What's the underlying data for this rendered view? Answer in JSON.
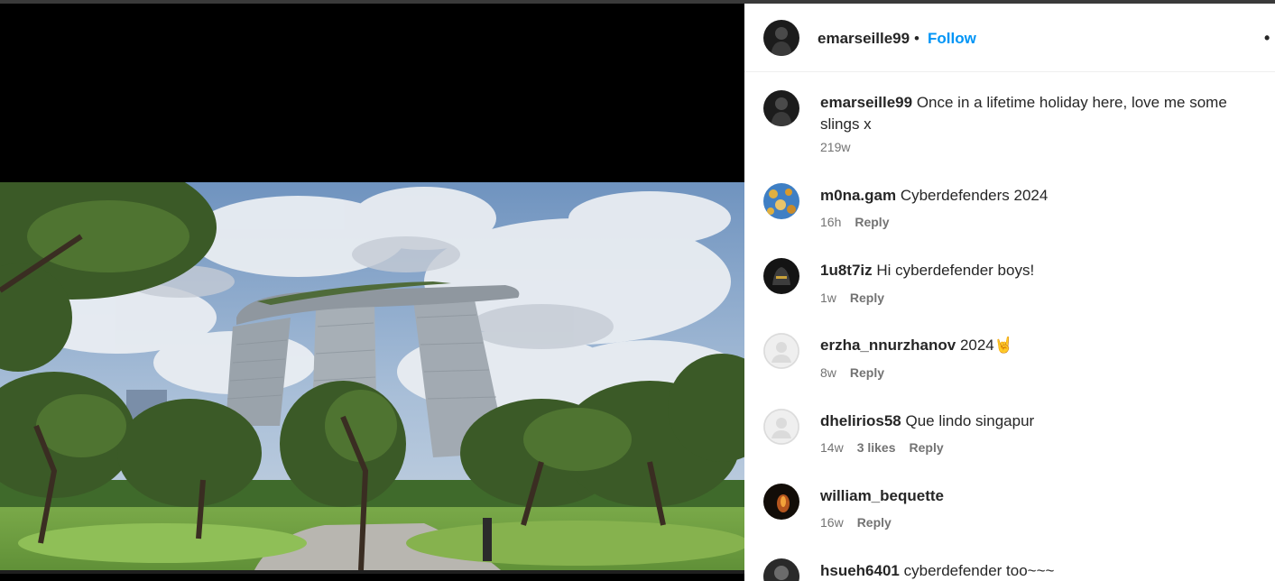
{
  "post": {
    "author": "emarseille99",
    "separator": "•",
    "follow_label": "Follow",
    "more_label": "•"
  },
  "caption": {
    "user": "emarseille99",
    "text": "Once in a lifetime holiday here, love me some slings x",
    "time": "219w"
  },
  "comments": [
    {
      "user": "m0na.gam",
      "text": "Cyberdefenders 2024",
      "time": "16h",
      "likes": "",
      "reply": "Reply"
    },
    {
      "user": "1u8t7iz",
      "text": "Hi cyberdefender boys!",
      "time": "1w",
      "likes": "",
      "reply": "Reply"
    },
    {
      "user": "erzha_nnurzhanov",
      "text": "2024🤘",
      "time": "8w",
      "likes": "",
      "reply": "Reply"
    },
    {
      "user": "dhelirios58",
      "text": "Que lindo singapur",
      "time": "14w",
      "likes": "3 likes",
      "reply": "Reply"
    },
    {
      "user": "william_bequette",
      "text": "",
      "time": "16w",
      "likes": "",
      "reply": "Reply"
    },
    {
      "user": "hsueh6401",
      "text": "cyberdefender too~~~",
      "time": "",
      "likes": "",
      "reply": ""
    }
  ],
  "colors": {
    "follow": "#0095f6",
    "meta": "#737373",
    "text": "#262626"
  },
  "icons": {
    "post_avatar": "user-avatar-dark",
    "default_avatar": "default-user-icon"
  }
}
